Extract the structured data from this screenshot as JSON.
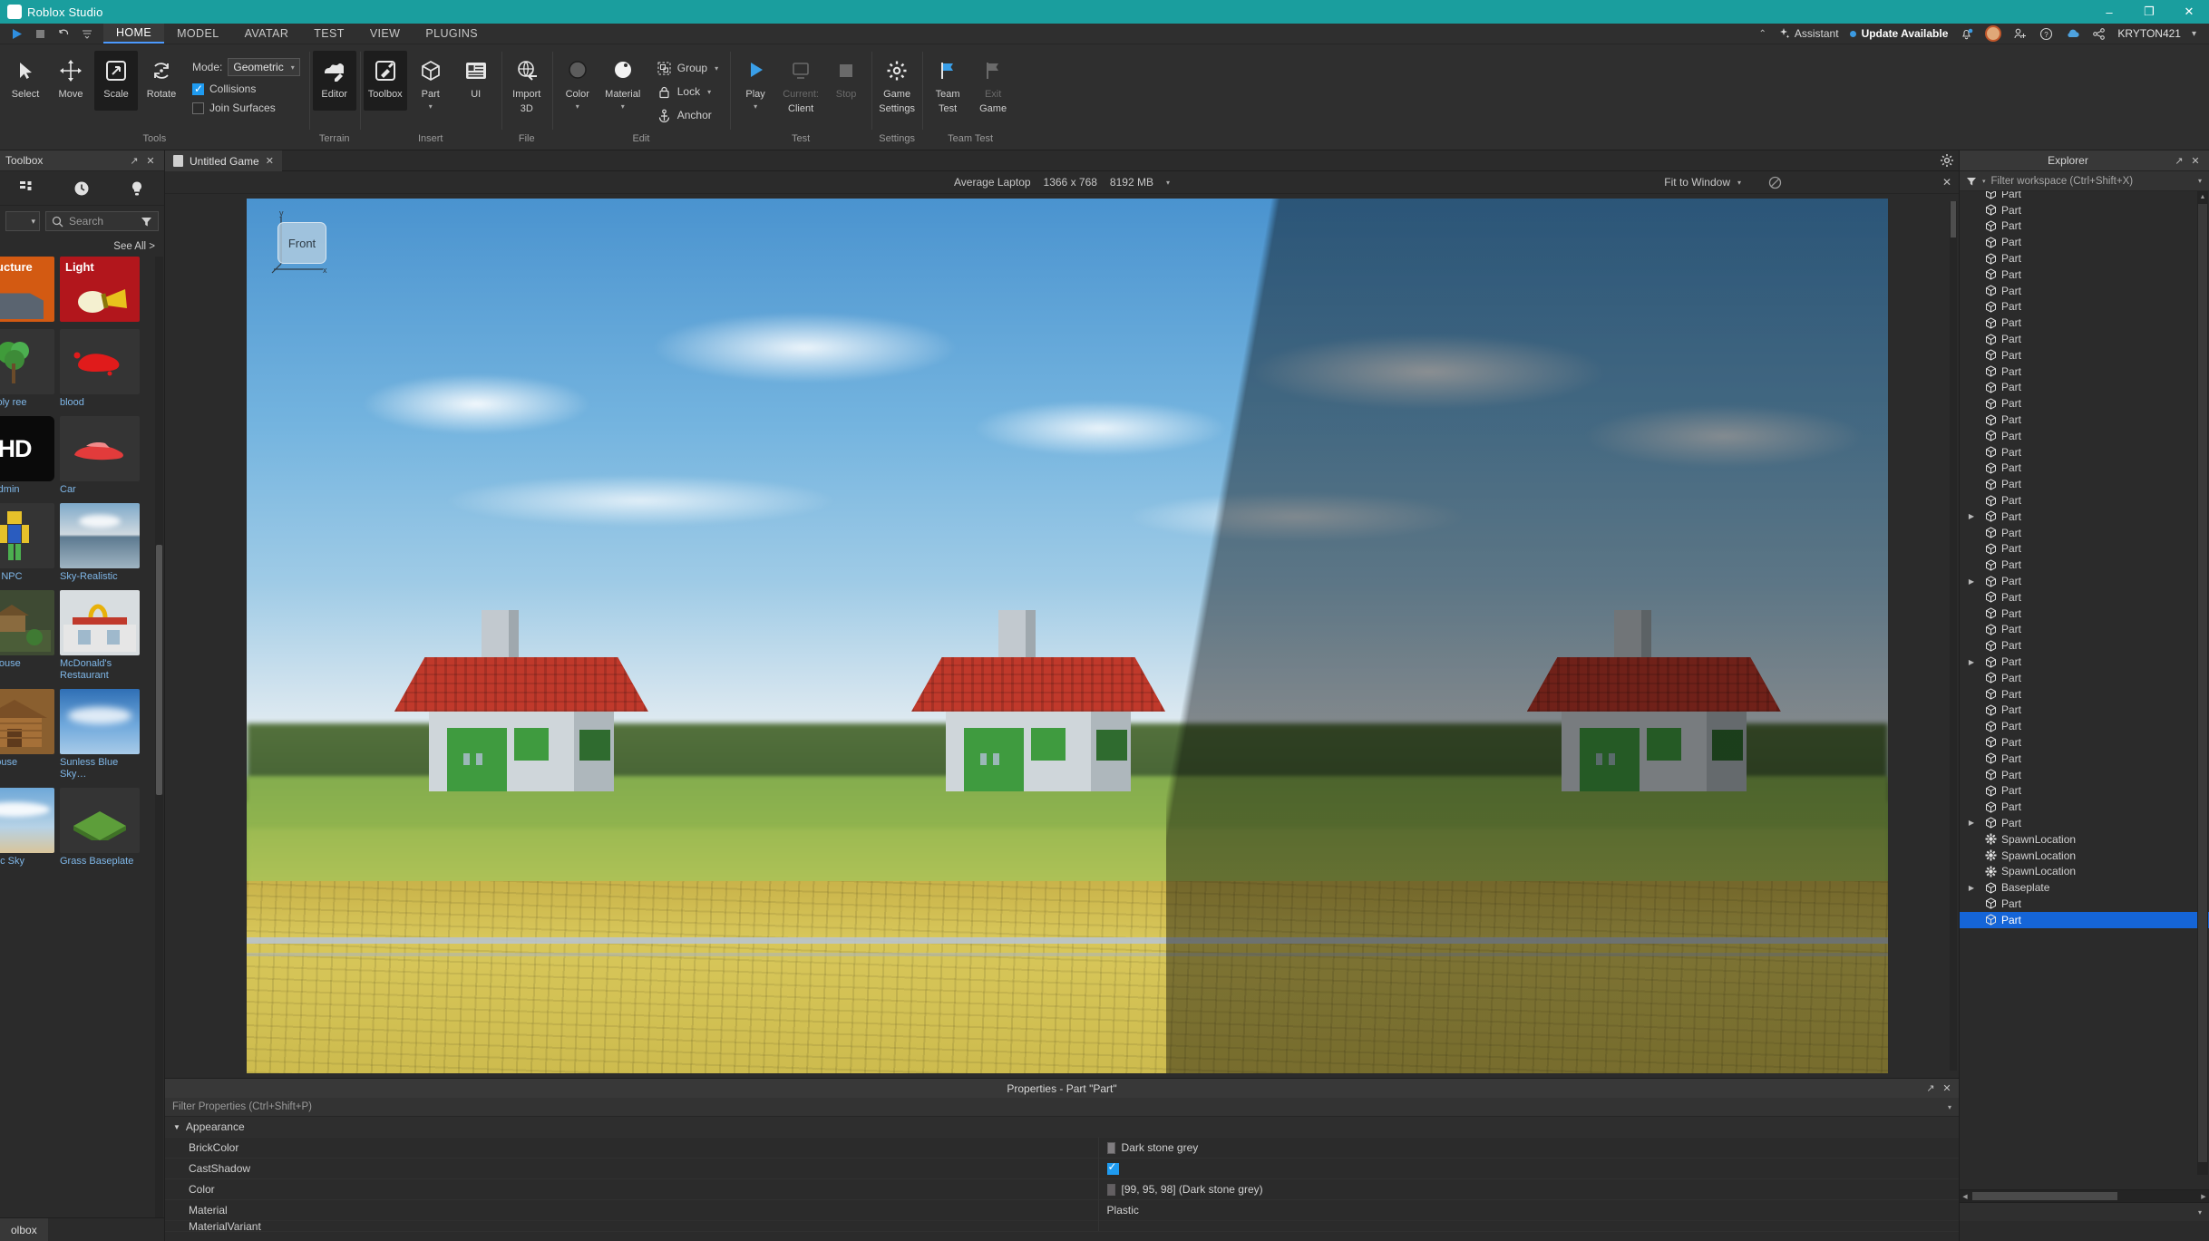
{
  "titlebar": {
    "app_title": "Roblox Studio",
    "minimize": "–",
    "maximize": "❐",
    "close": "✕"
  },
  "quick_access": {
    "play": "play-icon",
    "stop": "stop-icon",
    "undo": "undo-icon",
    "more": "more-icon"
  },
  "menu_tabs": [
    {
      "label": "HOME",
      "active": true
    },
    {
      "label": "MODEL",
      "active": false
    },
    {
      "label": "AVATAR",
      "active": false
    },
    {
      "label": "TEST",
      "active": false
    },
    {
      "label": "VIEW",
      "active": false
    },
    {
      "label": "PLUGINS",
      "active": false
    }
  ],
  "topright": {
    "collapse_caret": "⌃",
    "assistant_label": "Assistant",
    "update_label": "Update Available",
    "username": "KRYTON421",
    "user_caret": "▾"
  },
  "ribbon": {
    "groups": [
      {
        "label": "Tools",
        "buttons": [
          {
            "label": "Select",
            "selected": false
          },
          {
            "label": "Move",
            "selected": false
          },
          {
            "label": "Scale",
            "selected": true
          },
          {
            "label": "Rotate",
            "selected": false
          }
        ],
        "mode_label": "Mode:",
        "mode_value": "Geometric",
        "collisions_label": "Collisions",
        "collisions_checked": true,
        "join_label": "Join Surfaces",
        "join_checked": false
      },
      {
        "label": "Terrain",
        "buttons": [
          {
            "label": "Editor",
            "selected": true
          }
        ]
      },
      {
        "label": "Insert",
        "buttons": [
          {
            "label": "Toolbox",
            "selected": true
          },
          {
            "label": "Part",
            "selected": false,
            "caret": "▾"
          },
          {
            "label": "UI",
            "selected": false
          }
        ]
      },
      {
        "label": "File",
        "buttons": [
          {
            "label": "Import",
            "label2": "3D",
            "selected": false
          }
        ]
      },
      {
        "label": "Edit",
        "buttons": [
          {
            "label": "Color",
            "selected": false,
            "caret": "▾"
          },
          {
            "label": "Material",
            "selected": false,
            "caret": "▾"
          }
        ],
        "rows": [
          {
            "label": "Group",
            "caret": "▾"
          },
          {
            "label": "Lock",
            "caret": "▾"
          },
          {
            "label": "Anchor"
          }
        ]
      },
      {
        "label": "Test",
        "buttons": [
          {
            "label": "Play",
            "selected": false,
            "caret": "▾"
          },
          {
            "label": "Current:",
            "label2": "Client",
            "selected": false,
            "disabled": true,
            "caret": "▾"
          },
          {
            "label": "Stop",
            "selected": false,
            "disabled": true
          }
        ]
      },
      {
        "label": "Settings",
        "buttons": [
          {
            "label": "Game",
            "label2": "Settings",
            "selected": false
          }
        ]
      },
      {
        "label": "Team Test",
        "buttons": [
          {
            "label": "Team",
            "label2": "Test",
            "selected": false
          },
          {
            "label": "Exit",
            "label2": "Game",
            "selected": false,
            "disabled": true
          }
        ]
      }
    ]
  },
  "toolbox": {
    "title": "Toolbox",
    "popout": "↗",
    "close": "✕",
    "icon_tabs": [
      "grid-icon",
      "clock-icon",
      "lightbulb-icon"
    ],
    "category_caret": "▾",
    "search_placeholder": "Search",
    "see_all": "See All >",
    "items": [
      {
        "caption": "Structure",
        "kind": "structure-card"
      },
      {
        "caption": "Light",
        "kind": "light-card"
      },
      {
        "caption": "ow Poly\nree",
        "kind": "tree"
      },
      {
        "caption": "blood",
        "kind": "blood"
      },
      {
        "caption": "HD Admin",
        "kind": "hd"
      },
      {
        "caption": "Car",
        "kind": "car"
      },
      {
        "caption": "Noob NPC",
        "kind": "noob"
      },
      {
        "caption": "Sky-Realistic",
        "kind": "sky"
      },
      {
        "caption": "ree House",
        "kind": "treehouse"
      },
      {
        "caption": "McDonald's Restaurant",
        "kind": "mcd"
      },
      {
        "caption": "og House",
        "kind": "loghouse"
      },
      {
        "caption": "Sunless Blue Sky…",
        "kind": "bluesky"
      },
      {
        "caption": "ealistic Sky",
        "kind": "realsky"
      },
      {
        "caption": "Grass Baseplate",
        "kind": "grassbase"
      }
    ],
    "bottom_tab": "olbox"
  },
  "game_tab": {
    "label": "Untitled Game",
    "close": "✕",
    "settings_icon": "gear-icon"
  },
  "viewport_bar": {
    "device": "Average Laptop",
    "resolution": "1366 x 768",
    "memory": "8192 MB",
    "memory_caret": "▾",
    "fit": "Fit to Window",
    "fit_caret": "▾",
    "no_icon": "no-entry-icon",
    "close": "✕"
  },
  "viewport": {
    "gizmo_label": "Front",
    "axis_x": "x",
    "axis_y": "y"
  },
  "properties": {
    "title": "Properties - Part \"Part\"",
    "popout": "↗",
    "close": "✕",
    "filter_placeholder": "Filter Properties (Ctrl+Shift+P)",
    "filter_caret": "▾",
    "sections": [
      {
        "name": "Appearance",
        "expanded": true,
        "caret": "▼",
        "rows": [
          {
            "name": "BrickColor",
            "value": "Dark stone grey",
            "type": "swatch",
            "swatch_color": "#807d80"
          },
          {
            "name": "CastShadow",
            "value": "",
            "type": "checkbox",
            "checked": true
          },
          {
            "name": "Color",
            "value": "[99, 95, 98] (Dark stone grey)",
            "type": "swatch",
            "swatch_color": "#635f62"
          },
          {
            "name": "Material",
            "value": "Plastic",
            "type": "text"
          },
          {
            "name": "MaterialVariant",
            "value": "",
            "type": "text"
          }
        ]
      }
    ]
  },
  "explorer": {
    "title": "Explorer",
    "popout": "↗",
    "close": "✕",
    "filter_placeholder": "Filter workspace (Ctrl+Shift+X)",
    "filter_icon": "funnel-icon",
    "filter_caret": "▾",
    "rows": [
      {
        "label": "Part",
        "icon": "part-icon",
        "expandable": false,
        "selected": false,
        "clipped": true
      },
      {
        "label": "Part",
        "icon": "part-icon",
        "expandable": false,
        "selected": false
      },
      {
        "label": "Part",
        "icon": "part-icon",
        "expandable": false,
        "selected": false
      },
      {
        "label": "Part",
        "icon": "part-icon",
        "expandable": false,
        "selected": false
      },
      {
        "label": "Part",
        "icon": "part-icon",
        "expandable": false,
        "selected": false
      },
      {
        "label": "Part",
        "icon": "part-icon",
        "expandable": false,
        "selected": false
      },
      {
        "label": "Part",
        "icon": "part-icon",
        "expandable": false,
        "selected": false
      },
      {
        "label": "Part",
        "icon": "part-icon",
        "expandable": false,
        "selected": false
      },
      {
        "label": "Part",
        "icon": "part-icon",
        "expandable": false,
        "selected": false
      },
      {
        "label": "Part",
        "icon": "part-icon",
        "expandable": false,
        "selected": false
      },
      {
        "label": "Part",
        "icon": "part-icon",
        "expandable": false,
        "selected": false
      },
      {
        "label": "Part",
        "icon": "part-icon",
        "expandable": false,
        "selected": false
      },
      {
        "label": "Part",
        "icon": "part-icon",
        "expandable": false,
        "selected": false
      },
      {
        "label": "Part",
        "icon": "part-icon",
        "expandable": false,
        "selected": false
      },
      {
        "label": "Part",
        "icon": "part-icon",
        "expandable": false,
        "selected": false
      },
      {
        "label": "Part",
        "icon": "part-icon",
        "expandable": false,
        "selected": false
      },
      {
        "label": "Part",
        "icon": "part-icon",
        "expandable": false,
        "selected": false
      },
      {
        "label": "Part",
        "icon": "part-icon",
        "expandable": false,
        "selected": false
      },
      {
        "label": "Part",
        "icon": "part-icon",
        "expandable": false,
        "selected": false
      },
      {
        "label": "Part",
        "icon": "part-icon",
        "expandable": false,
        "selected": false
      },
      {
        "label": "Part",
        "icon": "part-icon",
        "expandable": true,
        "selected": false
      },
      {
        "label": "Part",
        "icon": "part-icon",
        "expandable": false,
        "selected": false
      },
      {
        "label": "Part",
        "icon": "part-icon",
        "expandable": false,
        "selected": false
      },
      {
        "label": "Part",
        "icon": "part-icon",
        "expandable": false,
        "selected": false
      },
      {
        "label": "Part",
        "icon": "part-icon",
        "expandable": true,
        "selected": false
      },
      {
        "label": "Part",
        "icon": "part-icon",
        "expandable": false,
        "selected": false
      },
      {
        "label": "Part",
        "icon": "part-icon",
        "expandable": false,
        "selected": false
      },
      {
        "label": "Part",
        "icon": "part-icon",
        "expandable": false,
        "selected": false
      },
      {
        "label": "Part",
        "icon": "part-icon",
        "expandable": false,
        "selected": false
      },
      {
        "label": "Part",
        "icon": "part-icon",
        "expandable": true,
        "selected": false
      },
      {
        "label": "Part",
        "icon": "part-icon",
        "expandable": false,
        "selected": false
      },
      {
        "label": "Part",
        "icon": "part-icon",
        "expandable": false,
        "selected": false
      },
      {
        "label": "Part",
        "icon": "part-icon",
        "expandable": false,
        "selected": false
      },
      {
        "label": "Part",
        "icon": "part-icon",
        "expandable": false,
        "selected": false
      },
      {
        "label": "Part",
        "icon": "part-icon",
        "expandable": false,
        "selected": false
      },
      {
        "label": "Part",
        "icon": "part-icon",
        "expandable": false,
        "selected": false
      },
      {
        "label": "Part",
        "icon": "part-icon",
        "expandable": false,
        "selected": false
      },
      {
        "label": "Part",
        "icon": "part-icon",
        "expandable": false,
        "selected": false
      },
      {
        "label": "Part",
        "icon": "part-icon",
        "expandable": false,
        "selected": false
      },
      {
        "label": "Part",
        "icon": "part-icon",
        "expandable": true,
        "selected": false
      },
      {
        "label": "SpawnLocation",
        "icon": "spawn-icon",
        "expandable": false,
        "selected": false
      },
      {
        "label": "SpawnLocation",
        "icon": "spawn-icon",
        "expandable": false,
        "selected": false
      },
      {
        "label": "SpawnLocation",
        "icon": "spawn-icon",
        "expandable": false,
        "selected": false
      },
      {
        "label": "Baseplate",
        "icon": "part-icon",
        "expandable": true,
        "selected": false
      },
      {
        "label": "Part",
        "icon": "part-icon",
        "expandable": false,
        "selected": false
      },
      {
        "label": "Part",
        "icon": "part-icon",
        "expandable": false,
        "selected": true
      }
    ]
  },
  "colors": {
    "brand_teal": "#1a9e9e",
    "accent_blue": "#1565d8",
    "checkbox_blue": "#1f9bf0",
    "panel_bg": "#2b2b2b",
    "header_bg": "#383838",
    "ribbon_bg": "#2f2f2f",
    "link_blue": "#7fb7e8"
  }
}
